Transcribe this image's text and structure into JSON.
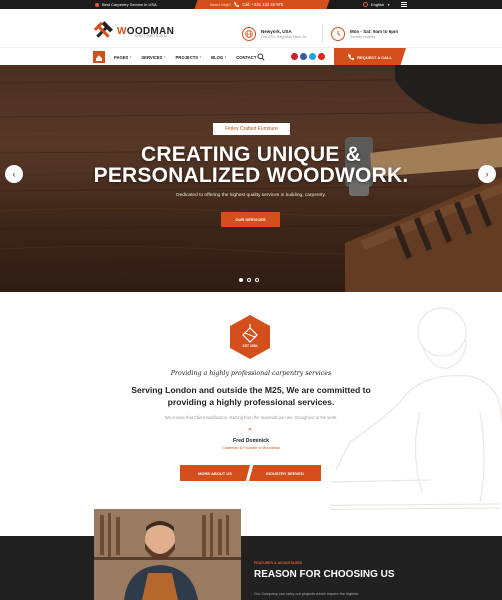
{
  "colors": {
    "accent": "#d3501c",
    "dark": "#1c1c1c",
    "dark_section": "#212121"
  },
  "topbar": {
    "tagline": "Best Carpentry Service in USA.",
    "need_help": "Need Help?",
    "phone": "Call: +321 123 45 978",
    "language": "English"
  },
  "header": {
    "logo_word": "W",
    "logo_rest": "OODMAN",
    "logo_tagline": "DON'T JUST BUILD...",
    "location_title": "Newyork, USA",
    "location_sub": "Flat 20/1, Reynolds Neck Str.",
    "hours_title": "Mon - Sat: 9am to 6pm",
    "hours_sub": "Sunday Holiday"
  },
  "nav": {
    "items": [
      {
        "label": "PAGES",
        "has_dropdown": true
      },
      {
        "label": "SERVICES",
        "has_dropdown": true
      },
      {
        "label": "PROJECTS",
        "has_dropdown": true
      },
      {
        "label": "BLOG",
        "has_dropdown": true
      },
      {
        "label": "CONTACT",
        "has_dropdown": false
      }
    ],
    "cta_label": "REQUEST A CALL",
    "socials": [
      {
        "icon": "pinterest-icon",
        "color": "#cb2027"
      },
      {
        "icon": "facebook-icon",
        "color": "#3b5998"
      },
      {
        "icon": "twitter-icon",
        "color": "#1da1f2"
      },
      {
        "icon": "youtube-icon",
        "color": "#e62117"
      }
    ]
  },
  "hero": {
    "badge": "Finley Crafted Furniture",
    "headline_1": "CREATING UNIQUE &",
    "headline_2": "PERSONALIZED WOODWORK.",
    "subtitle": "Dedicated to offering the highest quality services in building, carpentry.",
    "button": "OUR SERVICES",
    "prev_arrow": "‹",
    "next_arrow": "›",
    "slides_total": 3,
    "active_slide": 1
  },
  "about": {
    "badge_text": "EST 1994",
    "script_heading": "Providing a highly professional carpentry services",
    "lead": "Serving London and outside the M25, We are committed to providing a highly professional services.",
    "note": "We ensure that Client satisfaction, starting from the materials we use, throughout to the work.",
    "divider": "✕",
    "person_name": "Fred Dominick",
    "person_role": "Chairman & Founder of Woodman",
    "button_1": "MORE ABOUT US",
    "button_2": "INDUSTRY SERVED"
  },
  "reasons": {
    "label": "FEATURES & ADVANTAGES",
    "title": "REASON FOR CHOOSING US",
    "body": "Our Company can carry out projects which require the highest"
  }
}
